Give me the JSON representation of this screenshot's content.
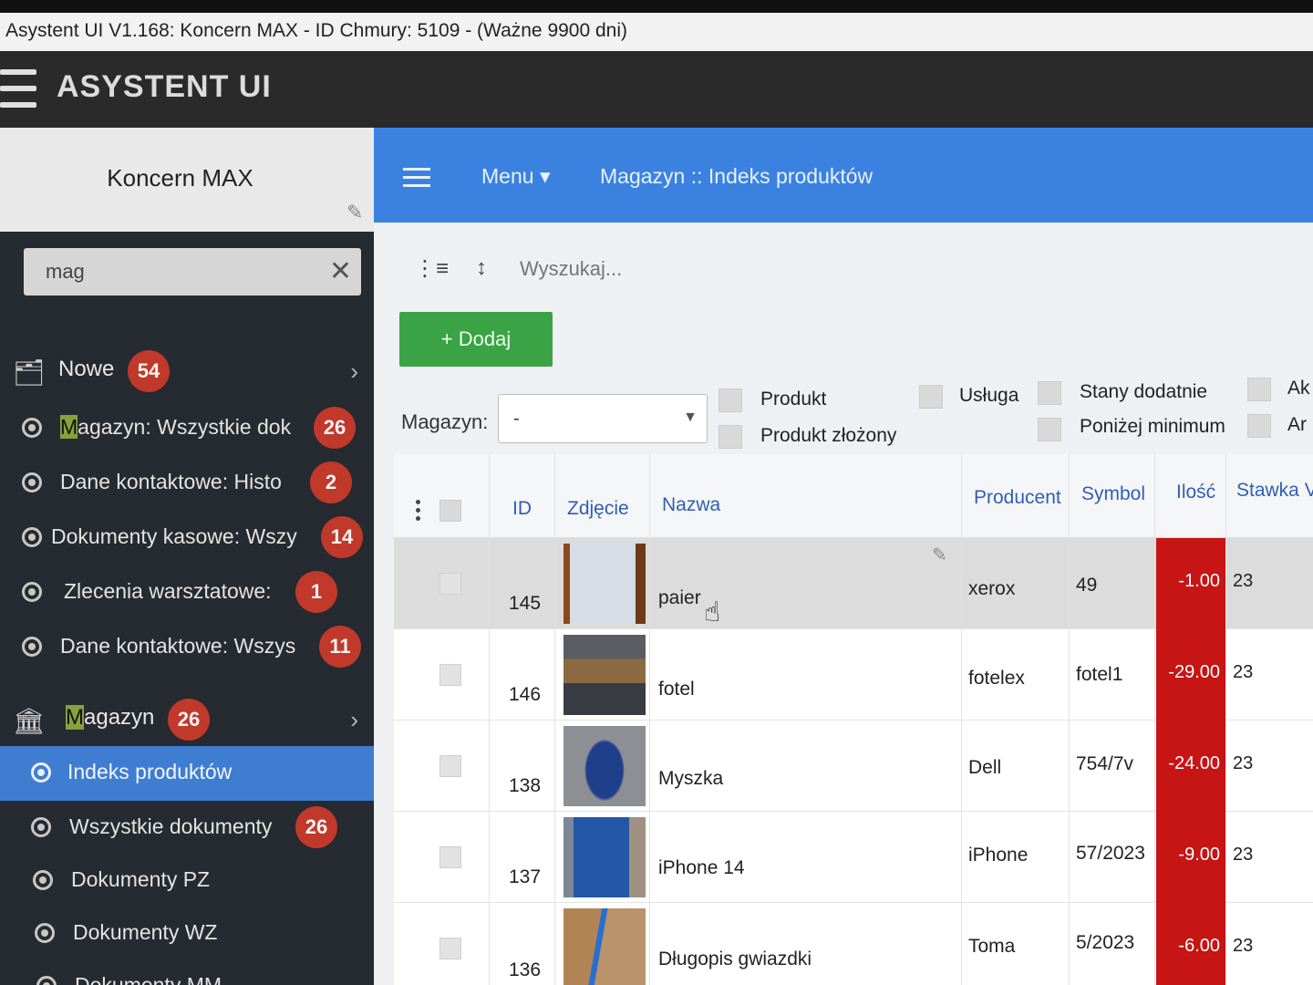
{
  "window": {
    "title": "Asystent UI V1.168: Koncern MAX - ID Chmury: 5109 - (Ważne 9900 dni)"
  },
  "app": {
    "title": "ASYSTENT UI"
  },
  "sidebar": {
    "company": "Koncern MAX",
    "search_value": "mag",
    "groups": [
      {
        "label": "Nowe",
        "badge": "54"
      },
      {
        "label": "Magazyn",
        "badge": "26"
      }
    ],
    "nowe_items": [
      {
        "label": "Magazyn: Wszystkie dok",
        "badge": "26"
      },
      {
        "label": "Dane kontaktowe: Histo",
        "badge": "2"
      },
      {
        "label": "Dokumenty kasowe: Wszy",
        "badge": "14"
      },
      {
        "label": "Zlecenia warsztatowe:",
        "badge": "1"
      },
      {
        "label": "Dane kontaktowe: Wszys",
        "badge": "11"
      }
    ],
    "magazyn_items": [
      {
        "label": "Indeks produktów",
        "badge": ""
      },
      {
        "label": "Wszystkie dokumenty",
        "badge": "26"
      },
      {
        "label": "Dokumenty PZ",
        "badge": ""
      },
      {
        "label": "Dokumenty WZ",
        "badge": ""
      },
      {
        "label": "Dokumenty MM",
        "badge": ""
      }
    ]
  },
  "topnav": {
    "menu": "Menu",
    "breadcrumb": "Magazyn :: Indeks produktów"
  },
  "toolbar": {
    "search_placeholder": "Wyszukaj...",
    "add_label": "+ Dodaj"
  },
  "filters": {
    "magazyn_label": "Magazyn:",
    "magazyn_value": "-",
    "checkboxes": [
      "Produkt",
      "Produkt złożony",
      "Usługa",
      "Stany dodatnie",
      "Poniżej minimum",
      "Ak",
      "Ar"
    ]
  },
  "table": {
    "columns": [
      "ID",
      "Zdjęcie",
      "Nazwa",
      "Producent",
      "Symbol",
      "Ilość",
      "Stawka V"
    ],
    "rows": [
      {
        "id": "145",
        "name": "paier",
        "producer": "xerox",
        "symbol": "49",
        "qty": "-1.00",
        "vat": "23"
      },
      {
        "id": "146",
        "name": "fotel",
        "producer": "fotelex",
        "symbol": "fotel1",
        "qty": "-29.00",
        "vat": "23"
      },
      {
        "id": "138",
        "name": "Myszka",
        "producer": "Dell",
        "symbol": "754/7v",
        "qty": "-24.00",
        "vat": "23"
      },
      {
        "id": "137",
        "name": "iPhone 14",
        "producer": "iPhone",
        "symbol": "57/2023",
        "qty": "-9.00",
        "vat": "23"
      },
      {
        "id": "136",
        "name": "Długopis gwiazdki",
        "producer": "Toma",
        "symbol": "5/2023",
        "qty": "-6.00",
        "vat": "23"
      }
    ]
  },
  "colors": {
    "accent": "#3b82e0",
    "negative_qty": "#c71414",
    "add_button": "#3aa345",
    "badge": "#c0392b"
  }
}
